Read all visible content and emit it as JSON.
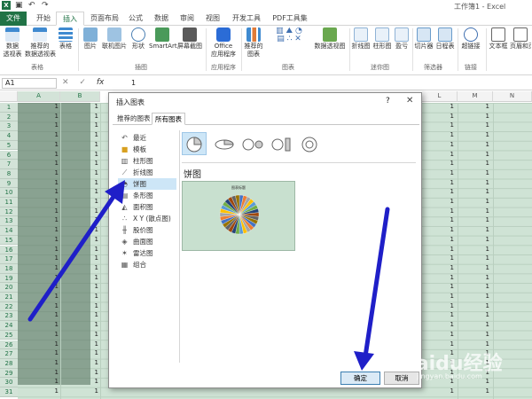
{
  "window": {
    "title": "工作簿1 - Excel"
  },
  "tabs": [
    "文件",
    "开始",
    "插入",
    "页面布局",
    "公式",
    "数据",
    "审阅",
    "视图",
    "开发工具",
    "PDF工具集"
  ],
  "active_tab": "插入",
  "ribbon": {
    "buttons": {
      "pivot": "数据\n透视表",
      "rec_pivot": "推荐的\n数据透视表",
      "table": "表格",
      "picture": "图片",
      "online_pic": "联机图片",
      "shapes": "形状",
      "smartart": "SmartArt",
      "screenshot": "屏幕截图",
      "office_apps": "Office\n应用程序",
      "rec_charts": "推荐的\n图表",
      "pivot_chart": "数据透视图",
      "line": "折线图",
      "column": "柱形图",
      "winloss": "盈亏",
      "slicer": "切片器",
      "timeline": "日程表",
      "hyperlink": "超链接",
      "textbox": "文本框",
      "headerfooter": "页眉和页"
    },
    "groups": {
      "tables": "表格",
      "illustrations": "插图",
      "apps": "应用程序",
      "charts": "图表",
      "sparklines": "迷你图",
      "filters": "筛选器",
      "links": "链接"
    }
  },
  "formula_bar": {
    "name_box": "A1",
    "cancel": "✕",
    "enter": "✓",
    "fx": "fx",
    "value": "1"
  },
  "columns": [
    "A",
    "B",
    "L",
    "M",
    "N"
  ],
  "rows": [
    "1",
    "2",
    "3",
    "4",
    "5",
    "6",
    "7",
    "8",
    "9",
    "10",
    "11",
    "12",
    "13",
    "14",
    "15",
    "16",
    "17",
    "18",
    "19",
    "20",
    "21",
    "22",
    "23",
    "24",
    "25",
    "26",
    "27",
    "28",
    "29",
    "30",
    "31"
  ],
  "cell_value": "1",
  "dialog": {
    "title": "插入图表",
    "help": "?",
    "close": "✕",
    "tabs": [
      "推荐的图表",
      "所有图表"
    ],
    "active_tab": "所有图表",
    "chart_types": [
      "最近",
      "模板",
      "柱形图",
      "折线图",
      "饼图",
      "条形图",
      "面积图",
      "X Y (散点图)",
      "股价图",
      "曲面图",
      "雷达图",
      "组合"
    ],
    "selected_type": "饼图",
    "section_title": "饼图",
    "preview_title": "图表标题",
    "ok_button": "确定",
    "cancel_button": "取消"
  },
  "watermark": {
    "main": "Baidu经验",
    "sub": "jingyan.baidu.com"
  },
  "colors": {
    "excel_green": "#217346",
    "selection_blue": "#cde6f7",
    "arrow_blue": "#1f1fc8"
  }
}
